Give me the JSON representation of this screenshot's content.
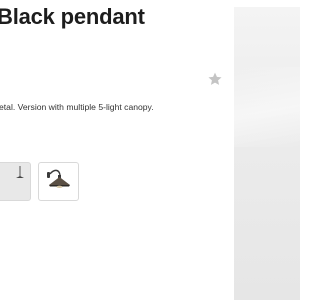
{
  "product": {
    "title": "Black pendant",
    "description": "etal. Version with multiple 5-light canopy."
  },
  "favorite": {
    "icon": "star-icon",
    "color": "#c4c4c4"
  },
  "thumbnails": [
    {
      "icon": "pendant-lamp-icon",
      "selected": true
    },
    {
      "icon": "wall-lamp-icon",
      "selected": false
    }
  ]
}
